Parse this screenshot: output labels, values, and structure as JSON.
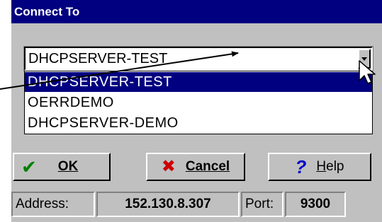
{
  "window": {
    "title": "Connect To"
  },
  "combo": {
    "selected": "DHCPSERVER-TEST",
    "open_icon": "chevron-down-icon"
  },
  "dropdown": {
    "items": [
      {
        "label": "DHCPSERVER-TEST",
        "selected": true
      },
      {
        "label": "OERRDEMO",
        "selected": false
      },
      {
        "label": "DHCPSERVER-DEMO",
        "selected": false
      }
    ]
  },
  "buttons": {
    "ok": {
      "label": "OK",
      "icon": "check-icon",
      "icon_color": "#008000"
    },
    "cancel": {
      "label": "Cancel",
      "icon": "close-icon",
      "icon_color": "#cc0000"
    },
    "help": {
      "label_h": "H",
      "label_rest": "elp",
      "icon": "question-icon",
      "icon_color": "#0000cc"
    }
  },
  "status": {
    "address_label": "Address:",
    "address_value": "152.130.8.307",
    "port_label": "Port:",
    "port_value": "9300"
  },
  "colors": {
    "title_bar": "#000080",
    "selection": "#000080",
    "face": "#c0c0c0"
  }
}
